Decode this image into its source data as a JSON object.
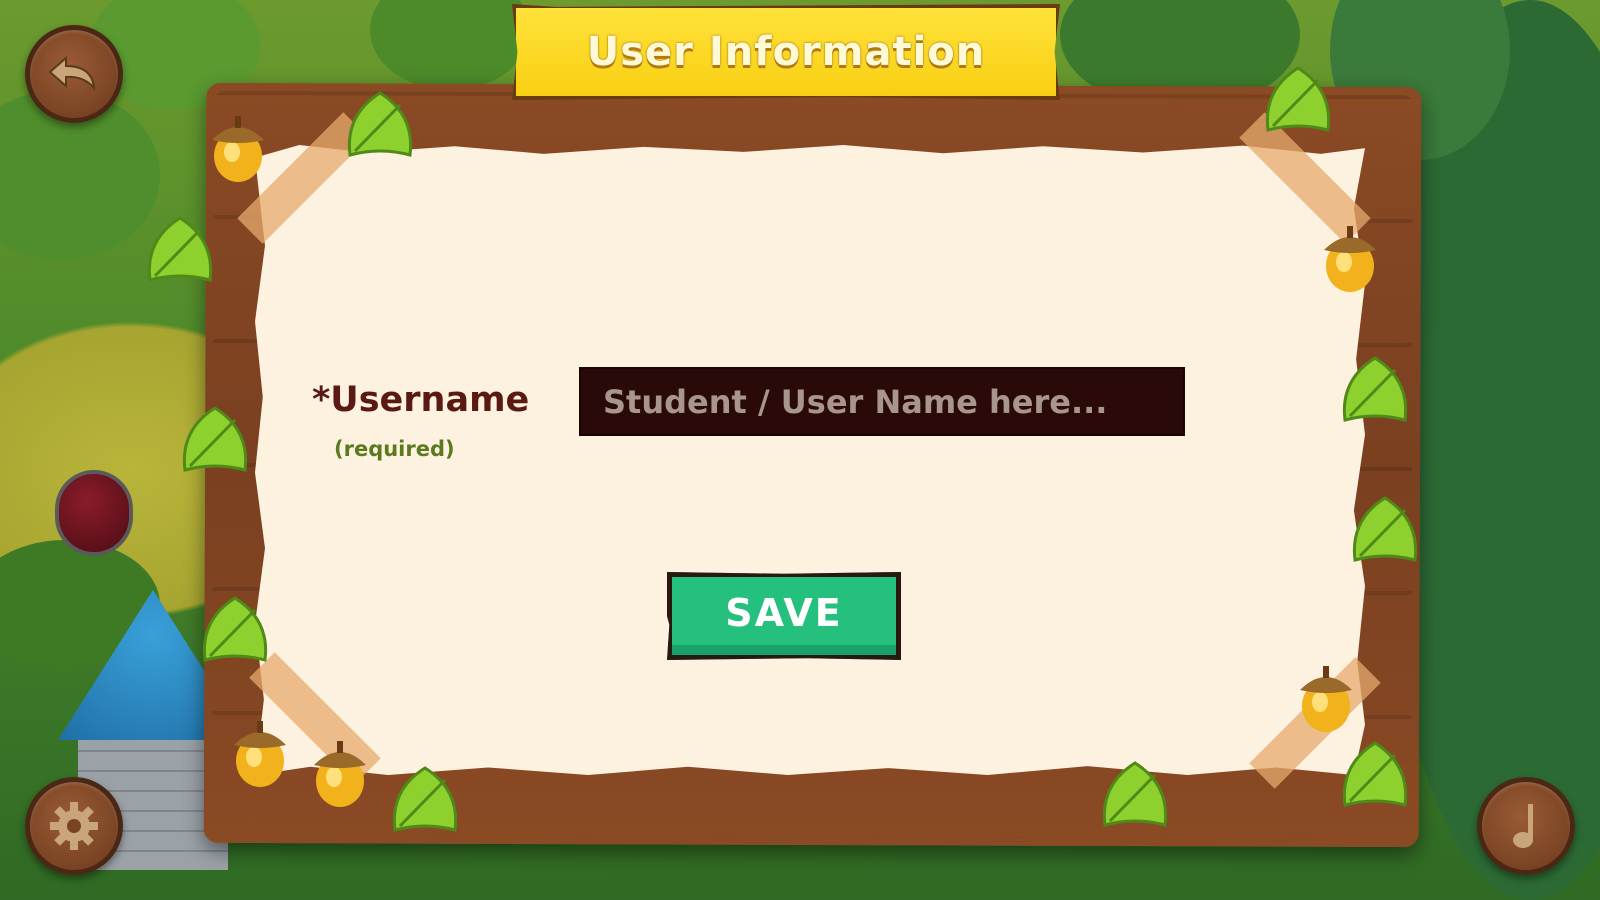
{
  "header": {
    "title": "User Information"
  },
  "form": {
    "username_label": "*Username",
    "username_note": "(required)",
    "username_value": "",
    "username_placeholder": "Student / User Name here...",
    "save_label": "SAVE"
  },
  "hud": {
    "back_icon": "back-arrow-icon",
    "settings_icon": "gear-icon",
    "music_icon": "music-note-icon"
  },
  "colors": {
    "banner": "#f8cf12",
    "save_button": "#26c07e",
    "input_background": "#2a0a08",
    "label_text": "#5a1a12",
    "note_text": "#5b7a1f",
    "paper": "#fdf2df",
    "wood": "#7a4020"
  }
}
